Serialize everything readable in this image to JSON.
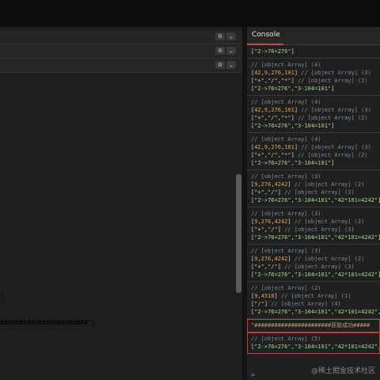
{
  "editor": {
    "header_icons": [
      "gear-icon",
      "chevron-down-icon"
    ],
    "code_fragments": [
      {
        "text": ")"
      },
      {
        "text": "#######################\")"
      }
    ]
  },
  "console": {
    "title": "Console",
    "prompt": ">",
    "entries": [
      {
        "lines": [
          [
            "[\"2->76=276\"]"
          ]
        ]
      },
      {
        "lines": [
          [
            "// [object Array] (4)"
          ],
          [
            "[42,9,276,101] // [object Array] (3)"
          ],
          [
            "[\"+\",\"/\",\"*\"] // [object Array] (2)"
          ],
          [
            "[\"2->76=276\",\"3-104=101\"]"
          ]
        ]
      },
      {
        "lines": [
          [
            "// [object Array] (4)"
          ],
          [
            "[42,9,276,101] // [object Array] (3)"
          ],
          [
            "[\"+\",\"/\",\"*\"] // [object Array] (2)"
          ],
          [
            "[\"2->76=276\",\"3-104=101\"]"
          ]
        ]
      },
      {
        "lines": [
          [
            "// [object Array] (4)"
          ],
          [
            "[42,9,276,101] // [object Array] (3)"
          ],
          [
            "[\"+\",\"/\",\"*\"] // [object Array] (2)"
          ],
          [
            "[\"2->76=276\",\"3-104=101\"]"
          ]
        ]
      },
      {
        "lines": [
          [
            "// [object Array] (3)"
          ],
          [
            "[9,276,4242] // [object Array] (2)"
          ],
          [
            "[\"+\",\"/\"] // [object Array] (3)"
          ],
          [
            "[\"2->76=276\",\"3-104=101\",\"42*101=4242\"]"
          ]
        ]
      },
      {
        "lines": [
          [
            "// [object Array] (3)"
          ],
          [
            "[9,276,4242] // [object Array] (2)"
          ],
          [
            "[\"+\",\"/\"] // [object Array] (3)"
          ],
          [
            "[\"2->76=276\",\"3-104=101\",\"42*101=4242\"]"
          ]
        ]
      },
      {
        "lines": [
          [
            "// [object Array] (3)"
          ],
          [
            "[9,276,4242] // [object Array] (2)"
          ],
          [
            "[\"+\",\"/\"] // [object Array] (3)"
          ],
          [
            "[\"2->76=276\",\"3-104=101\",\"42*101=4242\"]"
          ]
        ]
      },
      {
        "lines": [
          [
            "// [object Array] (2)"
          ],
          [
            "[9,4518] // [object Array] (1)"
          ],
          [
            "[\"/\"] // [object Array] (4)"
          ],
          [
            "[\"2->76=276\",\"3-104=101\",\"42*101=4242\",\"42"
          ]
        ]
      },
      {
        "highlight": true,
        "lines": [
          [
            "\"#######################获取成功#####"
          ]
        ]
      },
      {
        "highlight": true,
        "lines": [
          [
            "// [object Array] (5)"
          ],
          [
            "[\"2->76=276\",\"3-104=101\",\"42*101=4242\",\"42"
          ]
        ]
      }
    ]
  },
  "watermark": "@稀土掘金技术社区",
  "colors": {
    "comment": "#7c8a98",
    "number": "#e8a34a",
    "string": "#a8d887",
    "highlight_border": "#c83a3a",
    "accent": "#c94b4b"
  }
}
